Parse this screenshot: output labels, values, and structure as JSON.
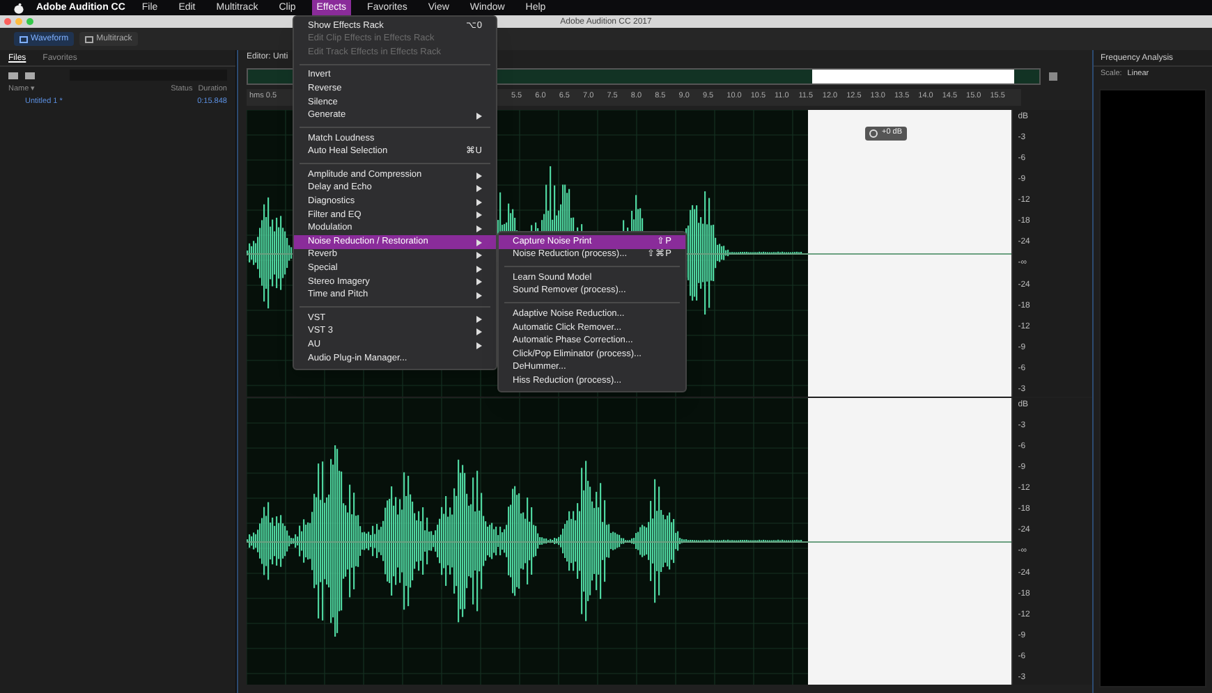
{
  "menu_bar": {
    "app_name": "Adobe Audition CC",
    "items": [
      {
        "label": "File",
        "selected": false
      },
      {
        "label": "Edit",
        "selected": false
      },
      {
        "label": "Multitrack",
        "selected": false
      },
      {
        "label": "Clip",
        "selected": false
      },
      {
        "label": "Effects",
        "selected": true
      },
      {
        "label": "Favorites",
        "selected": false
      },
      {
        "label": "View",
        "selected": false
      },
      {
        "label": "Window",
        "selected": false
      },
      {
        "label": "Help",
        "selected": false
      }
    ]
  },
  "window": {
    "title": "Adobe Audition CC 2017"
  },
  "toolbar": {
    "modes": [
      {
        "label": "Waveform",
        "selected": true
      },
      {
        "label": "Multitrack",
        "selected": false
      }
    ]
  },
  "files_panel": {
    "tabs": [
      {
        "label": "Files",
        "selected": true
      },
      {
        "label": "Favorites",
        "selected": false
      }
    ],
    "columns": [
      "Name ▾",
      "Status",
      "Duration"
    ],
    "files": [
      {
        "name": "Untitled 1 *",
        "duration": "0:15.848"
      }
    ]
  },
  "editor": {
    "tab": "Editor: Unti",
    "ruler_start": "hms 0.5",
    "ticks": [
      "5.5",
      "6.0",
      "6.5",
      "7.0",
      "7.5",
      "8.0",
      "8.5",
      "9.0",
      "9.5",
      "10.0",
      "10.5",
      "11.0",
      "11.5",
      "12.0",
      "12.5",
      "13.0",
      "13.5",
      "14.0",
      "14.5",
      "15.0",
      "15.5"
    ],
    "hud_reading": "+0 dB",
    "channels": [
      {
        "db_scale": [
          "dB",
          "-3",
          "-6",
          "-9",
          "-12",
          "-18",
          "-24",
          "-∞",
          "-24",
          "-18",
          "-12",
          "-9",
          "-6",
          "-3"
        ]
      },
      {
        "db_scale": [
          "dB",
          "-3",
          "-6",
          "-9",
          "-12",
          "-18",
          "-24",
          "-∞",
          "-24",
          "-18",
          "-12",
          "-9",
          "-6",
          "-3"
        ]
      }
    ]
  },
  "frequency_analysis": {
    "title": "Frequency Analysis",
    "scale_label": "Scale:",
    "scale_value": "Linear"
  },
  "effects_menu": {
    "items": [
      {
        "kind": "item",
        "label": "Show Effects Rack",
        "shortcut": "⌥0",
        "disabled": false,
        "submenu": false,
        "selected": false
      },
      {
        "kind": "item",
        "label": "Edit Clip Effects in Effects Rack",
        "disabled": true,
        "submenu": false,
        "selected": false
      },
      {
        "kind": "item",
        "label": "Edit Track Effects in Effects Rack",
        "disabled": true,
        "submenu": false,
        "selected": false
      },
      {
        "kind": "separator"
      },
      {
        "kind": "item",
        "label": "Invert",
        "disabled": false,
        "submenu": false,
        "selected": false
      },
      {
        "kind": "item",
        "label": "Reverse",
        "disabled": false,
        "submenu": false,
        "selected": false
      },
      {
        "kind": "item",
        "label": "Silence",
        "disabled": false,
        "submenu": false,
        "selected": false
      },
      {
        "kind": "item",
        "label": "Generate",
        "disabled": false,
        "submenu": true,
        "selected": false
      },
      {
        "kind": "separator"
      },
      {
        "kind": "item",
        "label": "Match Loudness",
        "disabled": false,
        "submenu": false,
        "selected": false
      },
      {
        "kind": "item",
        "label": "Auto Heal Selection",
        "shortcut": "⌘U",
        "disabled": false,
        "submenu": false,
        "selected": false
      },
      {
        "kind": "separator"
      },
      {
        "kind": "item",
        "label": "Amplitude and Compression",
        "disabled": false,
        "submenu": true,
        "selected": false
      },
      {
        "kind": "item",
        "label": "Delay and Echo",
        "disabled": false,
        "submenu": true,
        "selected": false
      },
      {
        "kind": "item",
        "label": "Diagnostics",
        "disabled": false,
        "submenu": true,
        "selected": false
      },
      {
        "kind": "item",
        "label": "Filter and EQ",
        "disabled": false,
        "submenu": true,
        "selected": false
      },
      {
        "kind": "item",
        "label": "Modulation",
        "disabled": false,
        "submenu": true,
        "selected": false
      },
      {
        "kind": "item",
        "label": "Noise Reduction / Restoration",
        "disabled": false,
        "submenu": true,
        "selected": true
      },
      {
        "kind": "item",
        "label": "Reverb",
        "disabled": false,
        "submenu": true,
        "selected": false
      },
      {
        "kind": "item",
        "label": "Special",
        "disabled": false,
        "submenu": true,
        "selected": false
      },
      {
        "kind": "item",
        "label": "Stereo Imagery",
        "disabled": false,
        "submenu": true,
        "selected": false
      },
      {
        "kind": "item",
        "label": "Time and Pitch",
        "disabled": false,
        "submenu": true,
        "selected": false
      },
      {
        "kind": "separator"
      },
      {
        "kind": "item",
        "label": "VST",
        "disabled": false,
        "submenu": true,
        "selected": false
      },
      {
        "kind": "item",
        "label": "VST 3",
        "disabled": false,
        "submenu": true,
        "selected": false
      },
      {
        "kind": "item",
        "label": "AU",
        "disabled": false,
        "submenu": true,
        "selected": false
      },
      {
        "kind": "item",
        "label": "Audio Plug-in Manager...",
        "disabled": false,
        "submenu": false,
        "selected": false
      }
    ]
  },
  "noise_submenu": {
    "items": [
      {
        "kind": "item",
        "label": "Capture Noise Print",
        "shortcut": "⇧P",
        "disabled": false,
        "submenu": false,
        "selected": true
      },
      {
        "kind": "item",
        "label": "Noise Reduction (process)...",
        "shortcut": "⇧⌘P",
        "disabled": false,
        "submenu": false,
        "selected": false
      },
      {
        "kind": "separator"
      },
      {
        "kind": "item",
        "label": "Learn Sound Model",
        "disabled": false,
        "submenu": false,
        "selected": false
      },
      {
        "kind": "item",
        "label": "Sound Remover (process)...",
        "disabled": false,
        "submenu": false,
        "selected": false
      },
      {
        "kind": "separator"
      },
      {
        "kind": "item",
        "label": "Adaptive Noise Reduction...",
        "disabled": false,
        "submenu": false,
        "selected": false
      },
      {
        "kind": "item",
        "label": "Automatic Click Remover...",
        "disabled": false,
        "submenu": false,
        "selected": false
      },
      {
        "kind": "item",
        "label": "Automatic Phase Correction...",
        "disabled": false,
        "submenu": false,
        "selected": false
      },
      {
        "kind": "item",
        "label": "Click/Pop Eliminator (process)...",
        "disabled": false,
        "submenu": false,
        "selected": false
      },
      {
        "kind": "item",
        "label": "DeHummer...",
        "disabled": false,
        "submenu": false,
        "selected": false
      },
      {
        "kind": "item",
        "label": "Hiss Reduction (process)...",
        "disabled": false,
        "submenu": false,
        "selected": false
      }
    ]
  }
}
